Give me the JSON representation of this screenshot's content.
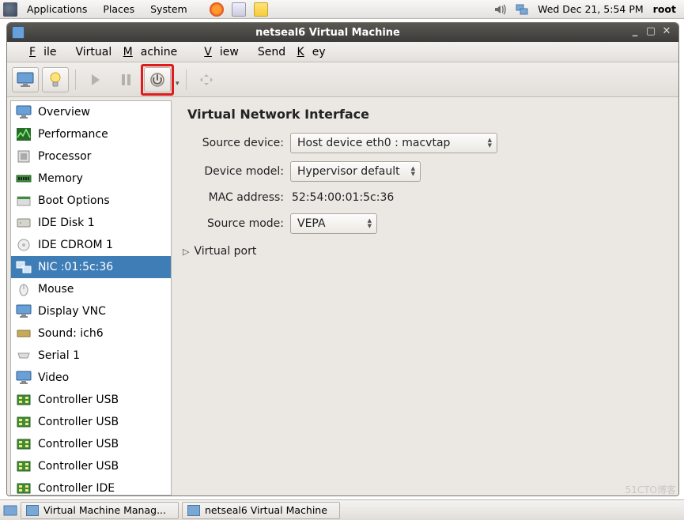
{
  "panel": {
    "menus": [
      "Applications",
      "Places",
      "System"
    ],
    "datetime": "Wed Dec 21,  5:54 PM",
    "user": "root"
  },
  "window": {
    "title": "netseal6 Virtual Machine",
    "menubar": {
      "file": "File",
      "file_mn": "F",
      "vm": "Virtual Machine",
      "vm_mn": "M",
      "view": "View",
      "view_mn": "V",
      "sendkey": "Send Key",
      "sendkey_mn": "K"
    }
  },
  "sidebar": {
    "items": [
      {
        "label": "Overview",
        "icon": "monitor"
      },
      {
        "label": "Performance",
        "icon": "perf"
      },
      {
        "label": "Processor",
        "icon": "cpu"
      },
      {
        "label": "Memory",
        "icon": "mem"
      },
      {
        "label": "Boot Options",
        "icon": "boot"
      },
      {
        "label": "IDE Disk 1",
        "icon": "disk"
      },
      {
        "label": "IDE CDROM 1",
        "icon": "cdrom"
      },
      {
        "label": "NIC :01:5c:36",
        "icon": "nic",
        "selected": true
      },
      {
        "label": "Mouse",
        "icon": "mouse"
      },
      {
        "label": "Display VNC",
        "icon": "monitor"
      },
      {
        "label": "Sound: ich6",
        "icon": "sound"
      },
      {
        "label": "Serial 1",
        "icon": "serial"
      },
      {
        "label": "Video",
        "icon": "monitor"
      },
      {
        "label": "Controller USB",
        "icon": "ctrl"
      },
      {
        "label": "Controller USB",
        "icon": "ctrl"
      },
      {
        "label": "Controller USB",
        "icon": "ctrl"
      },
      {
        "label": "Controller USB",
        "icon": "ctrl"
      },
      {
        "label": "Controller IDE",
        "icon": "ctrl"
      }
    ]
  },
  "content": {
    "heading": "Virtual Network Interface",
    "rows": {
      "source_device_label": "Source device:",
      "source_device_value": "Host device eth0 : macvtap",
      "device_model_label": "Device model:",
      "device_model_value": "Hypervisor default",
      "mac_label": "MAC address:",
      "mac_value": "52:54:00:01:5c:36",
      "source_mode_label": "Source mode:",
      "source_mode_value": "VEPA"
    },
    "expander": "Virtual port"
  },
  "taskbar": {
    "items": [
      "Virtual Machine Manag...",
      "netseal6 Virtual Machine"
    ]
  },
  "watermark": "51CTO博客"
}
